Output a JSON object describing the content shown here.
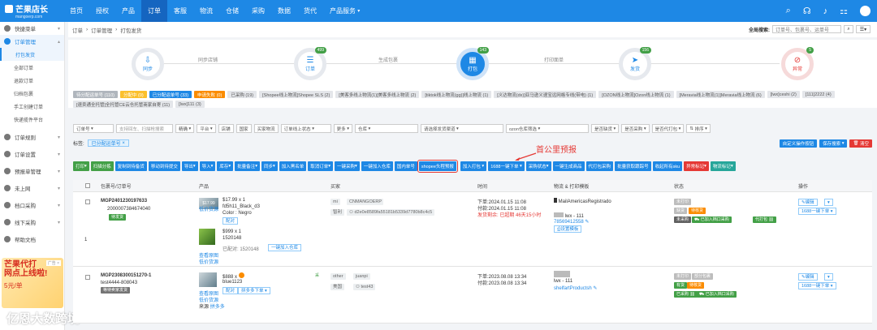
{
  "brand": {
    "name": "芒果店长",
    "sub": "mangoerp.com"
  },
  "nav": [
    "首页",
    "授权",
    "产品",
    "订单",
    "客服",
    "物流",
    "仓储",
    "采购",
    "数据",
    "货代",
    "产品服务"
  ],
  "sidebar": {
    "items": [
      {
        "label": "快捷菜单",
        "open": false
      },
      {
        "label": "订单管理",
        "open": true
      }
    ],
    "subitems": [
      "打包发货",
      "全部订单",
      "退款订单",
      "归档包裹",
      "手工创建订单",
      "快递揽件平台"
    ],
    "items2": [
      "订单规则",
      "订单设置",
      "预报单管理",
      "未上网",
      "档口采购",
      "线下采购",
      "帮助文档"
    ],
    "promo": {
      "line1": "芒果代打",
      "line2": "网点上线啦!",
      "line3": "5元/单",
      "badge": "广告 ×"
    },
    "watermark": "亿恩大数跨境"
  },
  "breadcrumb": [
    "订单",
    "订单管理",
    "打包发货"
  ],
  "global_search": {
    "label": "全局搜索:",
    "placeholder": "订单号、包裹号、运单号"
  },
  "flow": {
    "stages": [
      {
        "label": "同步",
        "count": ""
      },
      {
        "label": "订单",
        "count": "499"
      },
      {
        "label": "打包",
        "count": "143"
      },
      {
        "label": "发货",
        "count": "156"
      },
      {
        "label": "异常",
        "count": "5"
      }
    ],
    "steps": [
      "同步店铺",
      "生成包裹",
      "打印面单"
    ]
  },
  "tabs": [
    "待分配运单号 (110)",
    "分配中 (0)",
    "已分配运单号 (33)",
    "申请失败 (0)",
    "已采购 (19)",
    "[Shopee线上物流]Shopee SLS (2)",
    "[美客多线上物流(1)]美客多线上物流 (2)",
    "[tiktok线上物流(gg)]线上物流 (1)",
    "[义达物流(dx)]亚马逊义速宝远网格专线(带电) (1)",
    "[OZON线上物流]Ozon线上物流 (1)",
    "[Meravia线上物流(1)]Meravia线上物流 (6)",
    "[lwx]ceshi (2)",
    "[111]2222 (4)",
    "[速卖通全托管]全托管CE云仓托管商家自寄 (11)",
    "[lwx]111 (3)"
  ],
  "filters": [
    "订单号",
    "支持回车、扫描枪搜索",
    "精确",
    "平台",
    "店铺",
    "国家",
    "买家物流",
    "订单线上状态",
    "更多",
    "仓库",
    "请选择发货渠道",
    "ozon仓库筛选",
    "是否缺货",
    "是否采购",
    "是否代打包",
    "排序"
  ],
  "tag": {
    "label": "标签:",
    "value": "已分配运单号"
  },
  "right_buttons": [
    "自定义操作按钮",
    "保存搜索",
    "清空"
  ],
  "actions": [
    "打印",
    "扫描分拣",
    "复制到待备货",
    "移动到待提交",
    "导出",
    "导入",
    "库存",
    "批量备注",
    "同步",
    "加入黑名单",
    "取消订单",
    "一键采购",
    "一键加入仓库",
    "国内单号",
    "shopee头程预报",
    "加入打包",
    "1688一键下单",
    "采购状态",
    "一键生成商品",
    "代打包采购",
    "批量获取跟踪号",
    "收起所有sku",
    "异常标记",
    "物流标记"
  ],
  "annotation": "首公里预报",
  "table": {
    "headers": [
      "包裹号/订单号",
      "产品",
      "买家",
      "时间",
      "物流 & 打印模板",
      "状态",
      "操作"
    ],
    "rows": [
      {
        "index": "1",
        "package": "MGP2401230197633",
        "order": "2000007384674040",
        "pill": "待发货",
        "price": "$17.99",
        "p1": "$17.99 x 1",
        "sku1": "fd5h11_Black_d3",
        "color": "Color : Negro",
        "link1": "低价货源",
        "tag1": "配对",
        "p2": "$999 x 1",
        "sku2": "1520148",
        "paired": "已配对: 1520148",
        "addwh": "一键加入仓库",
        "img_links": [
          "查看原图",
          "低价货源"
        ],
        "buyer": {
          "tag1": "mi",
          "name1": "CNMANGOERP",
          "tag2": "智利",
          "name2": "d2e0e8589fa55181b5339d7780b8c4c5"
        },
        "time": {
          "order": "下单:2024.01.15 11:08",
          "pay": "付款:2024.01.15 11:08",
          "remain": "发货剩余: 已超期 46天15小时"
        },
        "logistics": {
          "carrier": "MailAmericasRegistrado",
          "user": "lwx - 111",
          "tracking": "78569412558",
          "tpl": "设置模板"
        },
        "status": {
          "s1": "未打印",
          "s2": "缺货",
          "s2b": "待核货",
          "s3": "未采购",
          "s3b": "已加入档口采购",
          "s3c": "代打包"
        },
        "op": {
          "edit": "编辑",
          "o1688": "1688一键下单"
        }
      },
      {
        "index": "",
        "package": "MGP2308300151270-1",
        "order": "test4444-808043",
        "pill": "等待卖家发货",
        "price": "",
        "p1": "$888 x",
        "sku1": "blue1123",
        "color": "",
        "link1": "低价货源",
        "tag1": "配对",
        "tag1b": "拼多多下单",
        "img_links": [
          "查看原图",
          "低价货源"
        ],
        "src": "来源",
        "src2": "拼多多",
        "buyer": {
          "tag1": "other",
          "name1": "juanpi",
          "tag2": "美国",
          "name2": "test43"
        },
        "time": {
          "order": "下单:2023.08.08 13:34",
          "pay": "付款:2023.08.08 13:34",
          "remain": ""
        },
        "logistics": {
          "carrier": "",
          "user": "lwx - 111",
          "tracking": "shelfartProductsh",
          "tpl": ""
        },
        "status": {
          "s1": "未打印",
          "s1b": "部分包裹",
          "s2": "有货",
          "s2b": "待核货",
          "s3": "已采购",
          "s3b": "已加入档口采购"
        },
        "op": {
          "edit": "编辑",
          "o1688": "1688一键下单"
        }
      }
    ]
  }
}
